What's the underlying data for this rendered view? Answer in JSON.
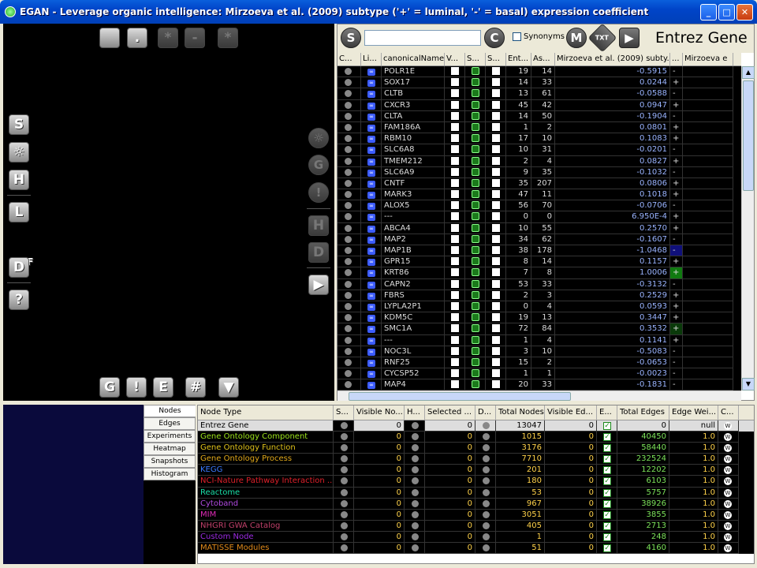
{
  "window": {
    "title": "EGAN - Leverage organic intelligence: Mirzoeva et al. (2009) subtype ('+' = luminal, '-' = basal) expression coefficient",
    "min": "_",
    "max": "□",
    "close": "✕"
  },
  "canvas": {
    "top_buttons": [
      "",
      ".",
      "*",
      "-",
      "*"
    ],
    "left_buttons": {
      "s": "S",
      "gear": "☼",
      "h": "H",
      "l": "L",
      "pdf": "PDF",
      "d": "D",
      "help": "?"
    },
    "right_buttons": {
      "gear": "☼",
      "g": "G",
      "warn": "!",
      "h": "H",
      "d": "D",
      "play": "▶"
    },
    "bottom_buttons": {
      "g": "G",
      "warn": "!",
      "e": "E",
      "hash": "#",
      "down": "▼"
    }
  },
  "toolbar": {
    "s": "S",
    "c": "C",
    "synonyms": "Synonyms",
    "m": "M",
    "txt": "TXT",
    "play": "▶",
    "title": "Entrez Gene",
    "search_value": ""
  },
  "grid": {
    "headers": [
      "C...",
      "Li...",
      "canonicalName",
      "V...",
      "S...",
      "S...",
      "Ent...",
      "As...",
      "Mirzoeva et al. (2009) subty...",
      "...",
      "Mirzoeva e"
    ],
    "rows": [
      {
        "name": "POLR1E",
        "ent": "19",
        "as": "14",
        "coef": "-0.5915",
        "sign": "-"
      },
      {
        "name": "SOX17",
        "ent": "14",
        "as": "33",
        "coef": "0.0244",
        "sign": "+"
      },
      {
        "name": "CLTB",
        "ent": "13",
        "as": "61",
        "coef": "-0.0588",
        "sign": "-"
      },
      {
        "name": "CXCR3",
        "ent": "45",
        "as": "42",
        "coef": "0.0947",
        "sign": "+"
      },
      {
        "name": "CLTA",
        "ent": "14",
        "as": "50",
        "coef": "-0.1904",
        "sign": "-"
      },
      {
        "name": "FAM186A",
        "ent": "1",
        "as": "2",
        "coef": "0.0801",
        "sign": "+"
      },
      {
        "name": "RBM10",
        "ent": "17",
        "as": "10",
        "coef": "0.1083",
        "sign": "+"
      },
      {
        "name": "SLC6A8",
        "ent": "10",
        "as": "31",
        "coef": "-0.0201",
        "sign": "-"
      },
      {
        "name": "TMEM212",
        "ent": "2",
        "as": "4",
        "coef": "0.0827",
        "sign": "+"
      },
      {
        "name": "SLC6A9",
        "ent": "9",
        "as": "35",
        "coef": "-0.1032",
        "sign": "-"
      },
      {
        "name": "CNTF",
        "ent": "35",
        "as": "207",
        "coef": "0.0806",
        "sign": "+"
      },
      {
        "name": "MARK3",
        "ent": "47",
        "as": "11",
        "coef": "0.1018",
        "sign": "+"
      },
      {
        "name": "ALOX5",
        "ent": "56",
        "as": "70",
        "coef": "-0.0706",
        "sign": "-"
      },
      {
        "name": "---",
        "ent": "0",
        "as": "0",
        "coef": "6.950E-4",
        "sign": "+"
      },
      {
        "name": "ABCA4",
        "ent": "10",
        "as": "55",
        "coef": "0.2570",
        "sign": "+"
      },
      {
        "name": "MAP2",
        "ent": "34",
        "as": "62",
        "coef": "-0.1607",
        "sign": "-"
      },
      {
        "name": "MAP1B",
        "ent": "38",
        "as": "178",
        "coef": "-1.0468",
        "sign": "-"
      },
      {
        "name": "GPR15",
        "ent": "8",
        "as": "14",
        "coef": "0.1157",
        "sign": "+"
      },
      {
        "name": "KRT86",
        "ent": "7",
        "as": "8",
        "coef": "1.0006",
        "sign": "+"
      },
      {
        "name": "CAPN2",
        "ent": "53",
        "as": "33",
        "coef": "-0.3132",
        "sign": "-"
      },
      {
        "name": "FBRS",
        "ent": "2",
        "as": "3",
        "coef": "0.2529",
        "sign": "+"
      },
      {
        "name": "LYPLA2P1",
        "ent": "0",
        "as": "4",
        "coef": "0.0593",
        "sign": "+"
      },
      {
        "name": "KDM5C",
        "ent": "19",
        "as": "13",
        "coef": "0.3447",
        "sign": "+"
      },
      {
        "name": "SMC1A",
        "ent": "72",
        "as": "84",
        "coef": "0.3532",
        "sign": "+"
      },
      {
        "name": "---",
        "ent": "1",
        "as": "4",
        "coef": "0.1141",
        "sign": "+"
      },
      {
        "name": "NOC3L",
        "ent": "3",
        "as": "10",
        "coef": "-0.5083",
        "sign": "-"
      },
      {
        "name": "RNF25",
        "ent": "15",
        "as": "2",
        "coef": "-0.0653",
        "sign": "-"
      },
      {
        "name": "CYCSP52",
        "ent": "1",
        "as": "1",
        "coef": "-0.0023",
        "sign": "-"
      },
      {
        "name": "MAP4",
        "ent": "20",
        "as": "33",
        "coef": "-0.1831",
        "sign": "-"
      }
    ]
  },
  "tabs": [
    "Nodes",
    "Edges",
    "Experiments",
    "Heatmap",
    "Snapshots",
    "Histogram"
  ],
  "nodes": {
    "headers": [
      "Node Type",
      "S...",
      "Visible No...",
      "H...",
      "Selected ...",
      "D...",
      "Total Nodes",
      "Visible Ed...",
      "E...",
      "Total Edges",
      "Edge Wei...",
      "C..."
    ],
    "rows": [
      {
        "type": "Entrez Gene",
        "color": "#000000",
        "visible": "0",
        "selected": "0",
        "total": "13047",
        "visedges": "0",
        "totaledges": "0",
        "weight": "null"
      },
      {
        "type": "Gene Ontology Component",
        "color": "#9be21a",
        "visible": "0",
        "selected": "0",
        "total": "1015",
        "visedges": "0",
        "totaledges": "40450",
        "weight": "1.0"
      },
      {
        "type": "Gene Ontology Function",
        "color": "#e0c21a",
        "visible": "0",
        "selected": "0",
        "total": "3176",
        "visedges": "0",
        "totaledges": "58440",
        "weight": "1.0"
      },
      {
        "type": "Gene Ontology Process",
        "color": "#e0a81a",
        "visible": "0",
        "selected": "0",
        "total": "7710",
        "visedges": "0",
        "totaledges": "232524",
        "weight": "1.0"
      },
      {
        "type": "KEGG",
        "color": "#3b7bff",
        "visible": "0",
        "selected": "0",
        "total": "201",
        "visedges": "0",
        "totaledges": "12202",
        "weight": "1.0"
      },
      {
        "type": "NCI-Nature Pathway Interaction ...",
        "color": "#e0202a",
        "visible": "0",
        "selected": "0",
        "total": "180",
        "visedges": "0",
        "totaledges": "6103",
        "weight": "1.0"
      },
      {
        "type": "Reactome",
        "color": "#1ae0a8",
        "visible": "0",
        "selected": "0",
        "total": "53",
        "visedges": "0",
        "totaledges": "5757",
        "weight": "1.0"
      },
      {
        "type": "Cytoband",
        "color": "#b04ae0",
        "visible": "0",
        "selected": "0",
        "total": "967",
        "visedges": "0",
        "totaledges": "38926",
        "weight": "1.0"
      },
      {
        "type": "MIM",
        "color": "#e02ab8",
        "visible": "0",
        "selected": "0",
        "total": "3051",
        "visedges": "0",
        "totaledges": "3855",
        "weight": "1.0"
      },
      {
        "type": "NHGRI GWA Catalog",
        "color": "#c0406a",
        "visible": "0",
        "selected": "0",
        "total": "405",
        "visedges": "0",
        "totaledges": "2713",
        "weight": "1.0"
      },
      {
        "type": "Custom Node",
        "color": "#9a2ae0",
        "visible": "0",
        "selected": "0",
        "total": "1",
        "visedges": "0",
        "totaledges": "248",
        "weight": "1.0"
      },
      {
        "type": "MATISSE Modules",
        "color": "#e08a1a",
        "visible": "0",
        "selected": "0",
        "total": "51",
        "visedges": "0",
        "totaledges": "4160",
        "weight": "1.0"
      }
    ]
  }
}
